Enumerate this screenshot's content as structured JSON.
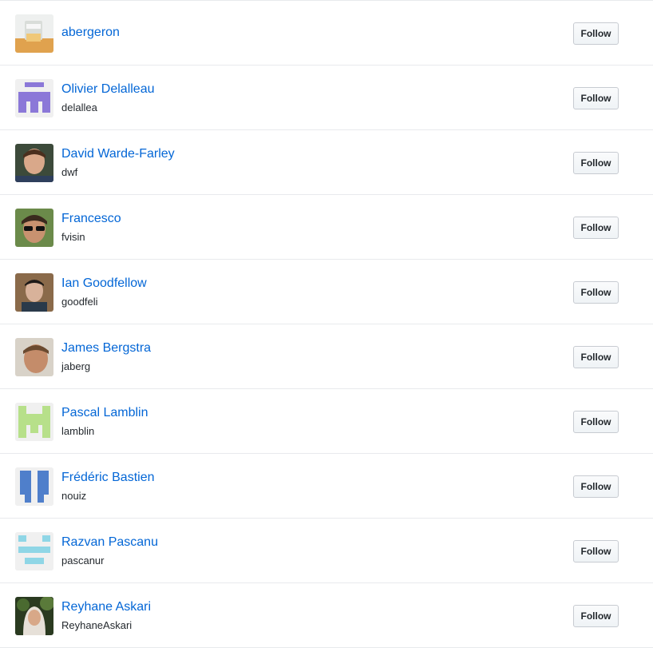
{
  "users": [
    {
      "name": "abergeron",
      "login": "",
      "avatar_icon": "photo-avatar-icon",
      "follow_label": "Follow"
    },
    {
      "name": "Olivier Delalleau",
      "login": "delallea",
      "avatar_icon": "identicon-avatar-icon",
      "follow_label": "Follow"
    },
    {
      "name": "David Warde-Farley",
      "login": "dwf",
      "avatar_icon": "photo-avatar-icon",
      "follow_label": "Follow"
    },
    {
      "name": "Francesco",
      "login": "fvisin",
      "avatar_icon": "photo-avatar-icon",
      "follow_label": "Follow"
    },
    {
      "name": "Ian Goodfellow",
      "login": "goodfeli",
      "avatar_icon": "photo-avatar-icon",
      "follow_label": "Follow"
    },
    {
      "name": "James Bergstra",
      "login": "jaberg",
      "avatar_icon": "photo-avatar-icon",
      "follow_label": "Follow"
    },
    {
      "name": "Pascal Lamblin",
      "login": "lamblin",
      "avatar_icon": "identicon-avatar-icon",
      "follow_label": "Follow"
    },
    {
      "name": "Frédéric Bastien",
      "login": "nouiz",
      "avatar_icon": "identicon-avatar-icon",
      "follow_label": "Follow"
    },
    {
      "name": "Razvan Pascanu",
      "login": "pascanur",
      "avatar_icon": "identicon-avatar-icon",
      "follow_label": "Follow"
    },
    {
      "name": "Reyhane Askari",
      "login": "ReyhaneAskari",
      "avatar_icon": "photo-avatar-icon",
      "follow_label": "Follow"
    }
  ],
  "colors": {
    "link": "#0366d6",
    "identicon_purple": "#8b78d8",
    "identicon_green": "#b7e08a",
    "identicon_blue": "#4f7fcb",
    "identicon_cyan": "#8fd6e6"
  }
}
